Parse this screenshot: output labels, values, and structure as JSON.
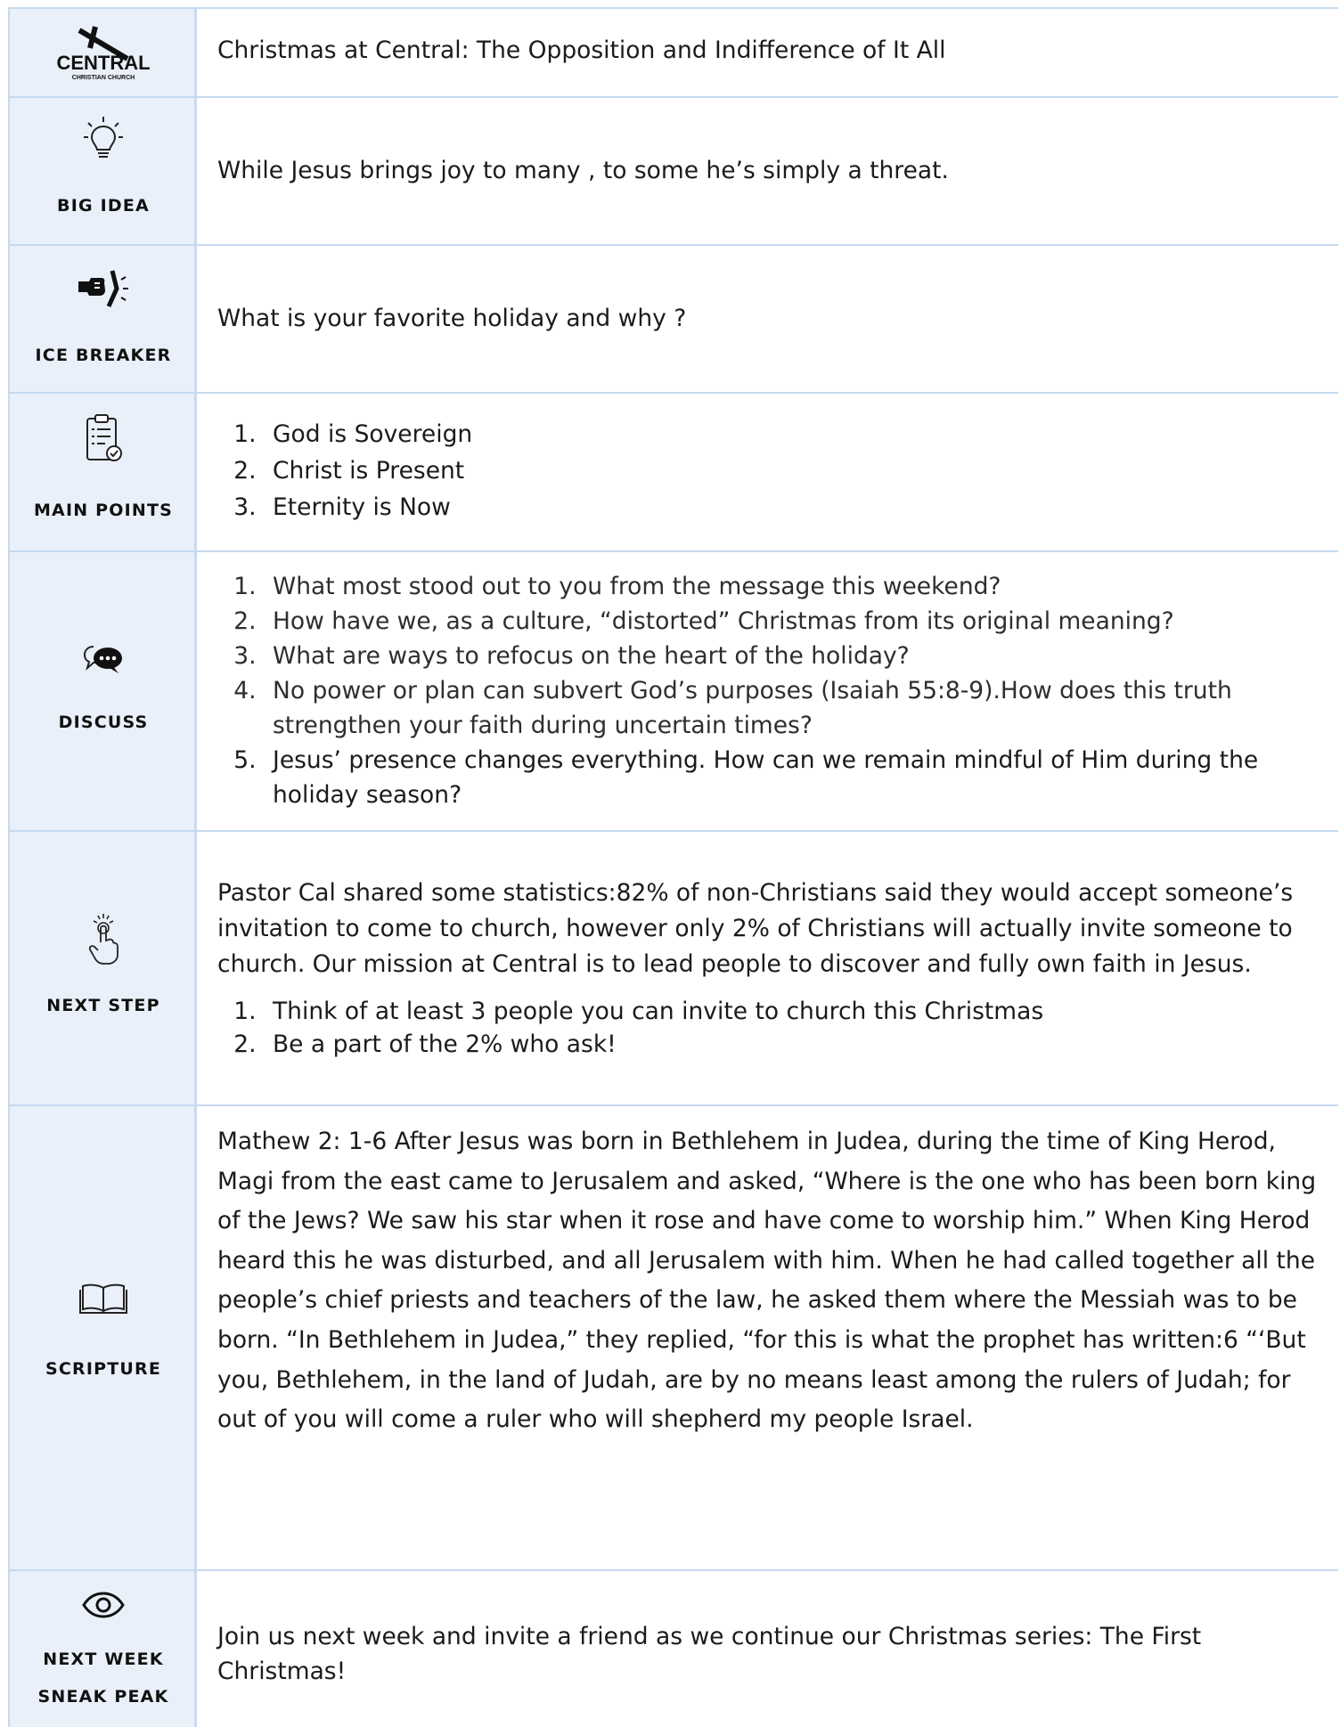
{
  "header": {
    "logo": {
      "wordmark": "CENTRAL",
      "subtitle": "CHRISTIAN CHURCH"
    },
    "title": "Christmas at Central: The Opposition and Indifference of It All"
  },
  "big_idea": {
    "label": "BIG IDEA",
    "icon": "lightbulb-icon",
    "text": "While Jesus brings joy to many , to some he’s simply a threat."
  },
  "ice_breaker": {
    "label": "ICE BREAKER",
    "icon": "fist-bump-icon",
    "text": "What is your favorite holiday and why ?"
  },
  "main_points": {
    "label": "MAIN POINTS",
    "icon": "clipboard-checklist-icon",
    "items": [
      "God is Sovereign",
      "Christ is Present",
      "Eternity is Now"
    ]
  },
  "discuss": {
    "label": "DISCUSS",
    "icon": "speech-bubbles-icon",
    "items": [
      "What most stood out to you from the message this weekend?",
      "How have we, as a culture, “distorted” Christmas from its original meaning?",
      "What are ways to refocus on the heart of the holiday?",
      "No power or plan can subvert God’s purposes (Isaiah 55:8-9).How does this truth strengthen your faith during uncertain times?",
      "Jesus’ presence changes everything. How can we remain mindful of Him during the holiday season?"
    ]
  },
  "next_step": {
    "label": "NEXT STEP",
    "icon": "hand-tap-icon",
    "paragraph": "Pastor Cal  shared some statistics:82% of non-Christians said they would accept someone’s invitation to come to church, however only 2% of Christians will actually invite someone to church. Our mission at Central is to lead people to discover and fully own faith in Jesus.",
    "items": [
      "Think of at least 3 people you can invite to church this Christmas",
      "Be a part of the 2% who ask!"
    ]
  },
  "scripture": {
    "label": "SCRIPTURE",
    "icon": "open-book-icon",
    "text": "Mathew 2: 1-6  After Jesus was born in Bethlehem in Judea, during the time of King Herod, Magi from the east came to Jerusalem  and asked, “Where is the one who has been born king of the Jews? We saw his star when it rose and have come to worship him.” When King Herod heard this he was disturbed, and all Jerusalem with him. When he had called together all the people’s chief priests and teachers of the law, he asked them where the Messiah was to be born. “In Bethlehem in Judea,” they replied, “for this is what the prophet has written:6 “‘But you, Bethlehem, in the land of Judah, are by no means least among the rulers of Judah; for out of you will come a ruler who will shepherd my people Israel."
  },
  "next_week": {
    "label_line1": "NEXT WEEK",
    "label_line2": "SNEAK PEAK",
    "icon": "eye-icon",
    "text": "Join us next week and invite a friend as we continue our Christmas series: The First Christmas!"
  }
}
